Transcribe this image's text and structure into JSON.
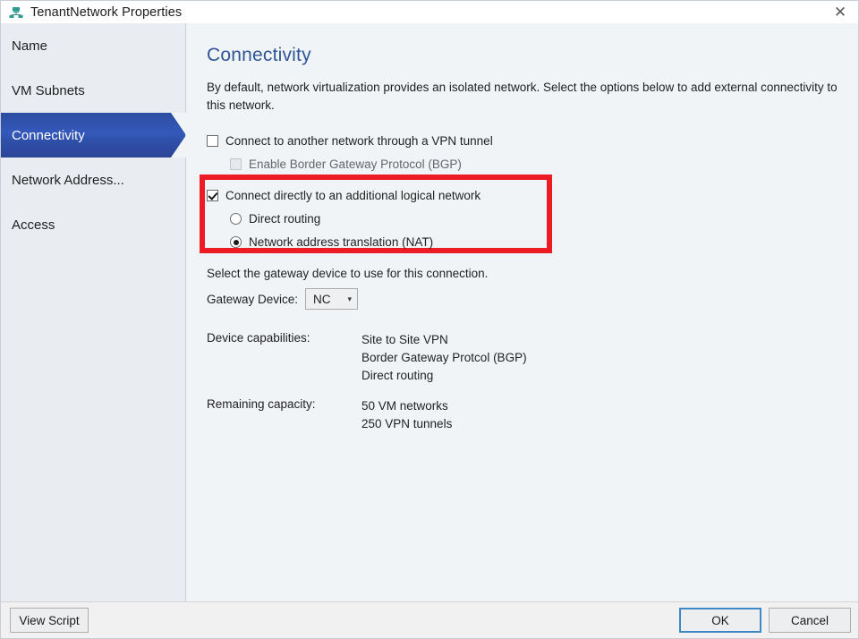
{
  "window": {
    "title": "TenantNetwork Properties",
    "icon": "network-tenant-icon",
    "close_label": "✕"
  },
  "sidebar": {
    "items": [
      {
        "label": "Name",
        "selected": false
      },
      {
        "label": "VM Subnets",
        "selected": false
      },
      {
        "label": "Connectivity",
        "selected": true
      },
      {
        "label": "Network Address...",
        "selected": false
      },
      {
        "label": "Access",
        "selected": false
      }
    ]
  },
  "main": {
    "page_title": "Connectivity",
    "intro": "By default, network virtualization provides an isolated network. Select the options below to add external connectivity to this network.",
    "options": {
      "vpn_tunnel": {
        "label": "Connect to another network through a VPN tunnel",
        "checked": false,
        "enabled": true
      },
      "bgp": {
        "label": "Enable Border Gateway Protocol (BGP)",
        "checked": false,
        "enabled": false
      },
      "additional_logical_network": {
        "label": "Connect directly to an additional logical network",
        "checked": true,
        "enabled": true
      },
      "direct_routing": {
        "label": "Direct routing",
        "selected": false
      },
      "nat": {
        "label": "Network address translation (NAT)",
        "selected": true
      }
    },
    "gateway_prompt": "Select the gateway device to use for this connection.",
    "gateway_device": {
      "label": "Gateway Device:",
      "value": "NC",
      "caret": "▾"
    },
    "device_capabilities": {
      "label": "Device capabilities:",
      "values": [
        "Site to Site VPN",
        "Border Gateway Protcol (BGP)",
        "Direct routing"
      ]
    },
    "remaining_capacity": {
      "label": "Remaining capacity:",
      "values": [
        "50 VM networks",
        "250 VPN tunnels"
      ]
    }
  },
  "footer": {
    "view_script": "View Script",
    "ok": "OK",
    "cancel": "Cancel"
  },
  "colors": {
    "accent_blue": "#2f5596",
    "selected_nav": "#3459bb",
    "highlight_red": "#ed1c24",
    "focus_blue": "#3d88c7",
    "sidebar_bg": "#e9edf1",
    "content_bg": "#f1f4f7"
  }
}
